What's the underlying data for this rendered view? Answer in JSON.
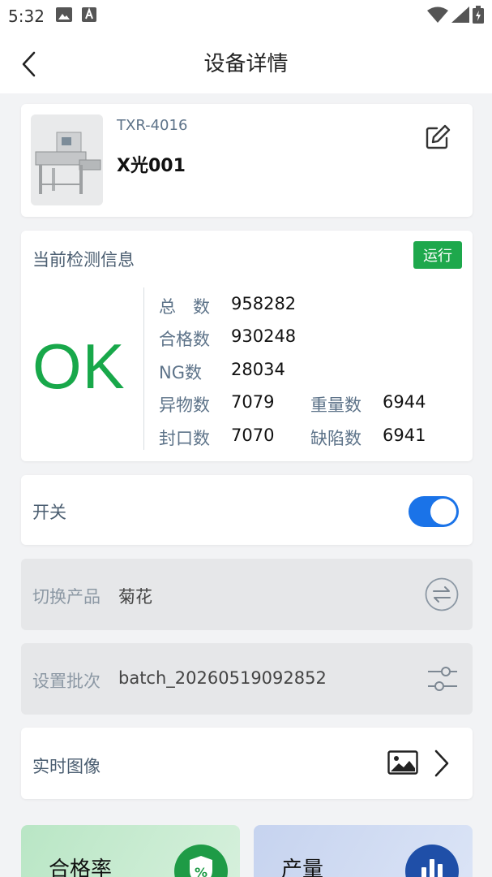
{
  "status_bar": {
    "time": "5:32"
  },
  "nav": {
    "title": "设备详情"
  },
  "device": {
    "model": "TXR-4016",
    "name": "X光001"
  },
  "detection": {
    "title": "当前检测信息",
    "status": "运行",
    "result": "OK",
    "stats": {
      "total_label": "总　数",
      "total": "958282",
      "pass_label": "合格数",
      "pass": "930248",
      "ng_label": "NG数",
      "ng": "28034",
      "foreign_label": "异物数",
      "foreign": "7079",
      "weight_label": "重量数",
      "weight": "6944",
      "seal_label": "封口数",
      "seal": "7070",
      "defect_label": "缺陷数",
      "defect": "6941"
    }
  },
  "switch": {
    "label": "开关",
    "on": true
  },
  "product": {
    "label": "切换产品",
    "value": "菊花"
  },
  "batch": {
    "label": "设置批次",
    "value": "batch_20260519092852"
  },
  "realtime": {
    "label": "实时图像"
  },
  "tiles": {
    "pass_rate": "合格率",
    "output": "产量"
  },
  "colors": {
    "accent_blue": "#1a73e8",
    "ok_green": "#18a84a",
    "tag_green": "#1ea84c"
  }
}
